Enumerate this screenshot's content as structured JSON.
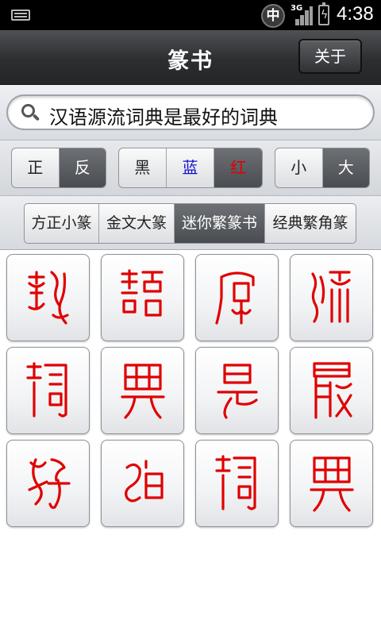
{
  "status_bar": {
    "ime_label": "中",
    "network_label": "3G",
    "time": "4:38"
  },
  "header": {
    "title": "篆书",
    "about_label": "关于"
  },
  "search": {
    "value": "汉语源流词典是最好的词典"
  },
  "display_options": {
    "orientation": [
      "正",
      "反"
    ],
    "orientation_selected": "反",
    "colors": [
      "黑",
      "蓝",
      "红"
    ],
    "color_values": [
      "#000000",
      "#1010d0",
      "#e00000"
    ],
    "color_selected": "红",
    "sizes": [
      "小",
      "大"
    ],
    "size_selected": "大"
  },
  "font_tabs": {
    "items": [
      "方正小篆",
      "金文大篆",
      "迷你繁篆书",
      "经典繁角篆"
    ],
    "selected": "迷你繁篆书"
  },
  "glyphs": {
    "ink_color": "#e00000",
    "count": 12
  }
}
